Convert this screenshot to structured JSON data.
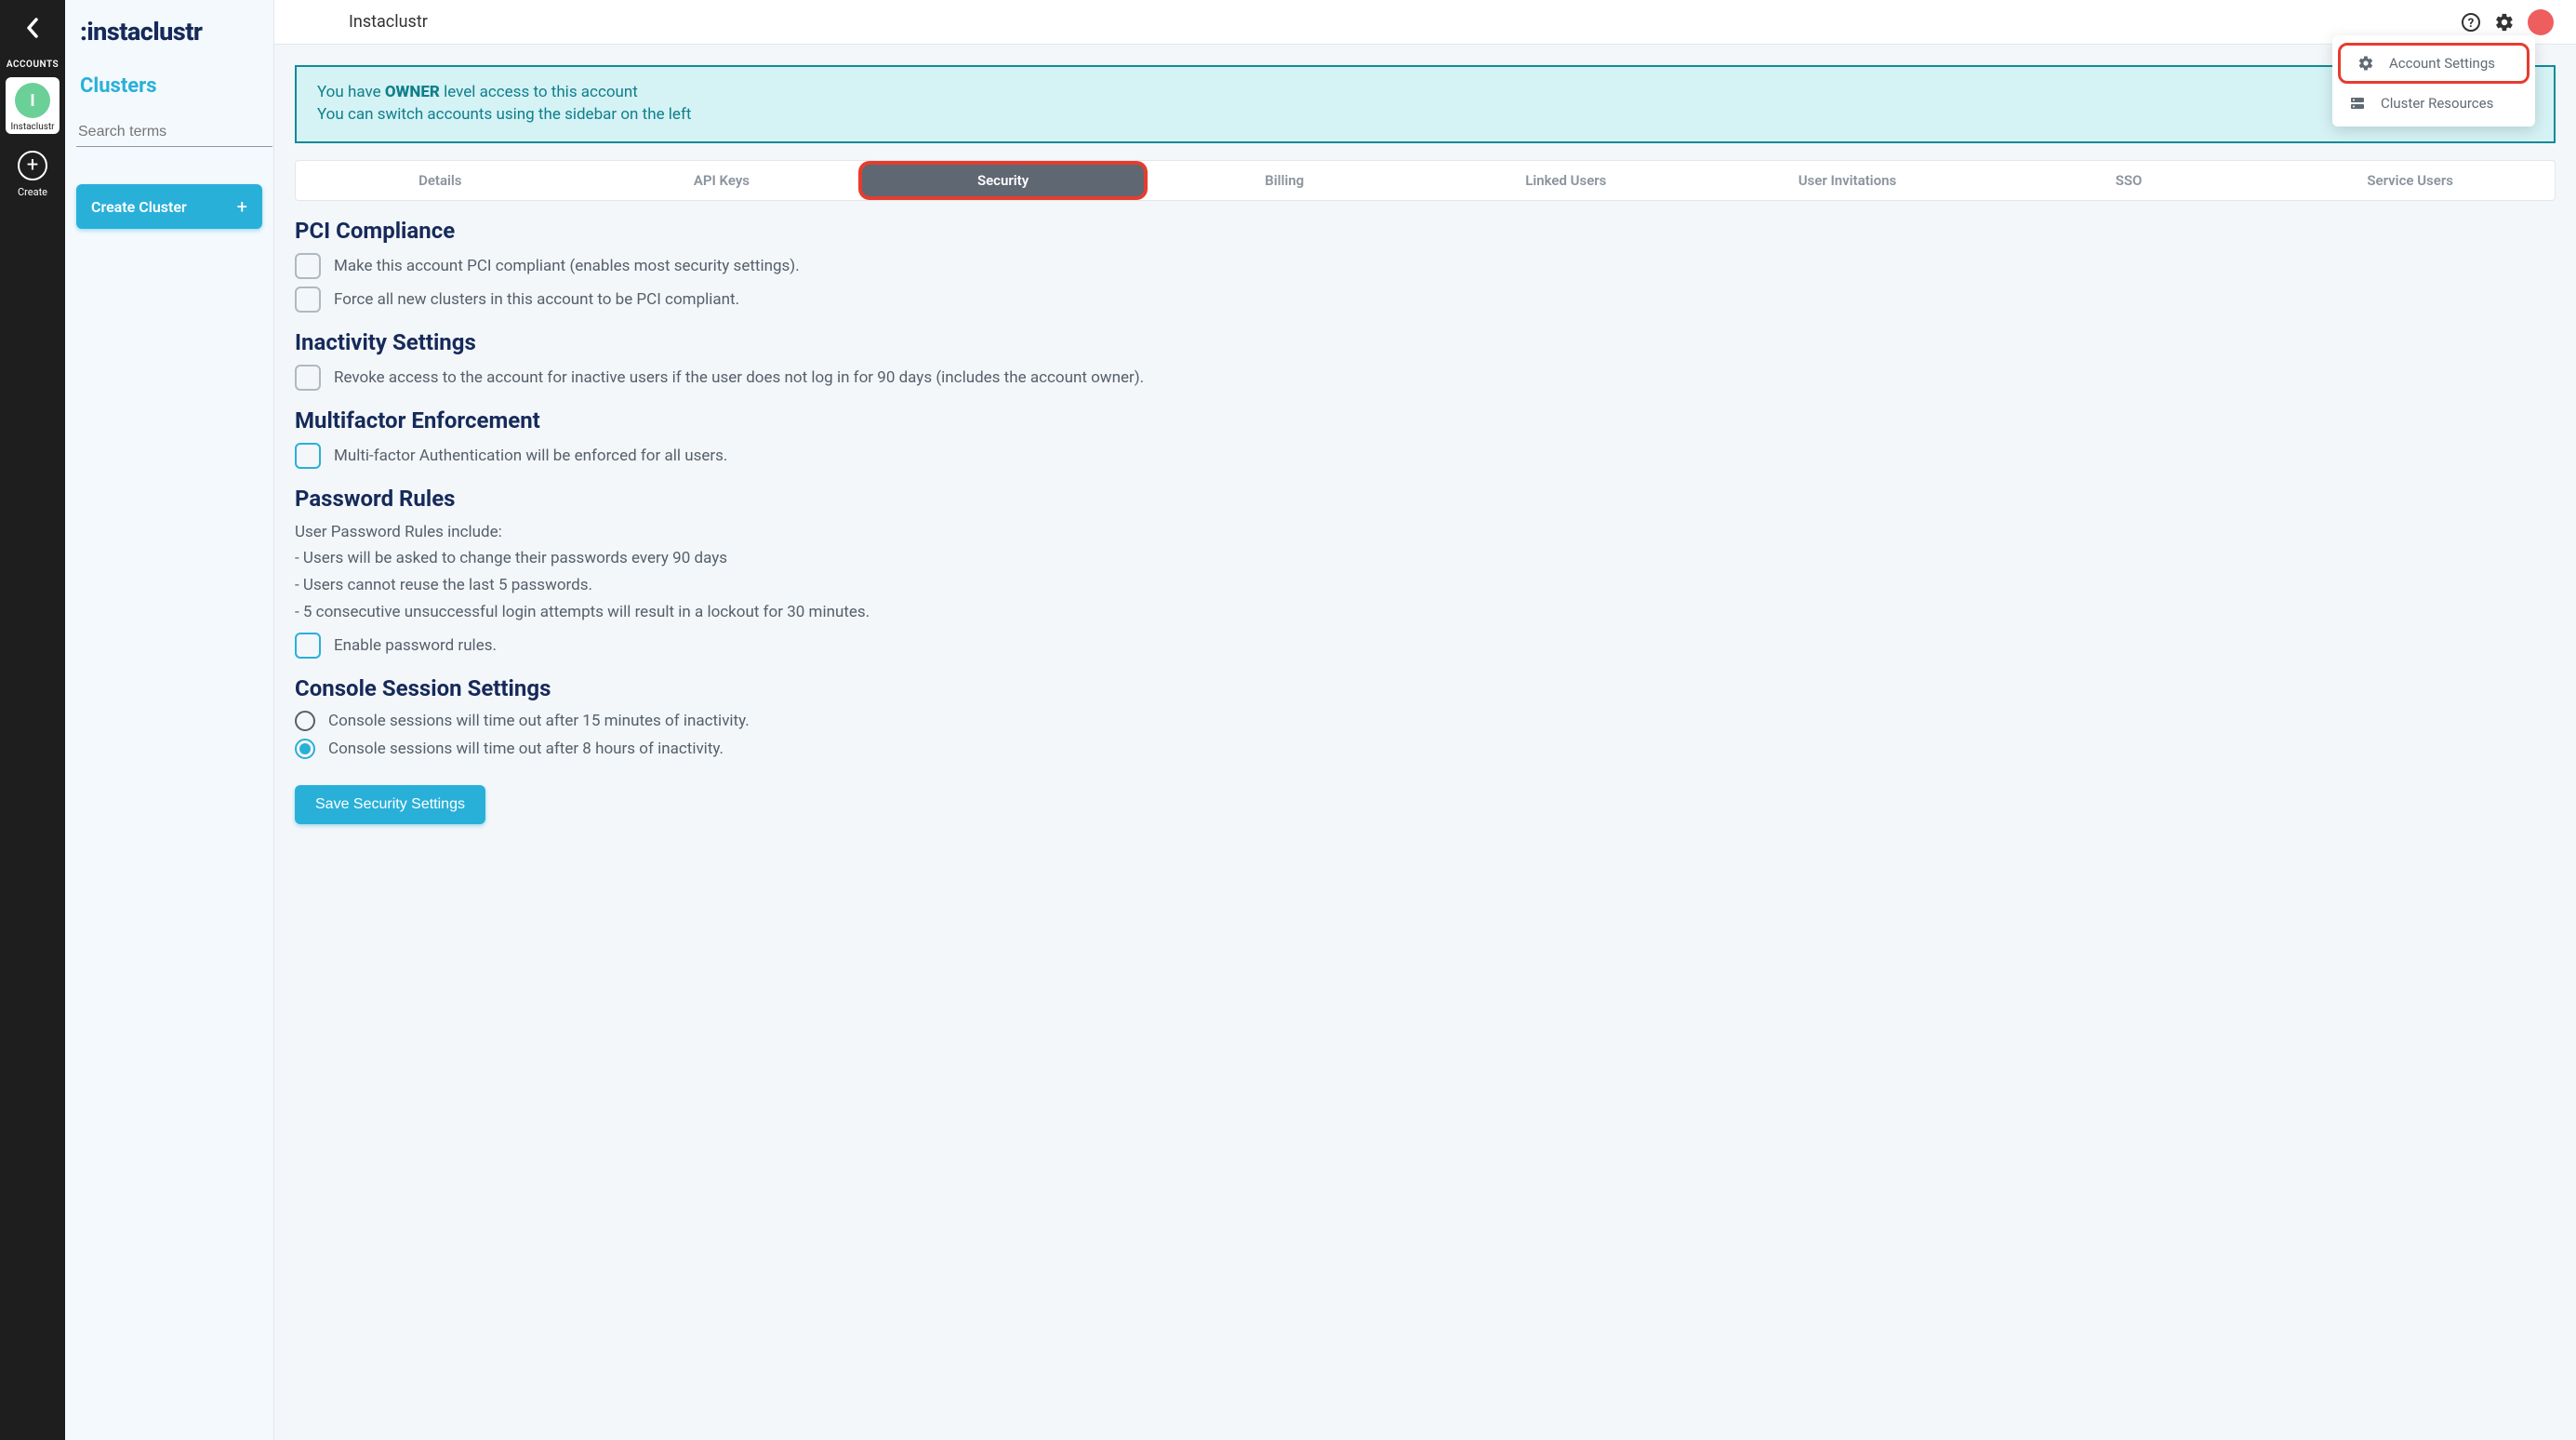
{
  "rail": {
    "accounts_label": "ACCOUNTS",
    "account_initial": "I",
    "account_name": "Instaclustr",
    "create_label": "Create"
  },
  "sidebar": {
    "brand": "instaclustr",
    "heading": "Clusters",
    "search_placeholder": "Search terms",
    "create_cluster_label": "Create Cluster"
  },
  "topbar": {
    "title": "Instaclustr"
  },
  "dropdown": {
    "items": [
      {
        "label": "Account Settings",
        "highlighted": true
      },
      {
        "label": "Cluster Resources",
        "highlighted": false
      }
    ]
  },
  "banner": {
    "line1_pre": "You have ",
    "line1_bold": "OWNER",
    "line1_post": " level access to this account",
    "line2": "You can switch accounts using the sidebar on the left"
  },
  "tabs": [
    {
      "label": "Details",
      "active": false
    },
    {
      "label": "API Keys",
      "active": false
    },
    {
      "label": "Security",
      "active": true
    },
    {
      "label": "Billing",
      "active": false
    },
    {
      "label": "Linked Users",
      "active": false
    },
    {
      "label": "User Invitations",
      "active": false
    },
    {
      "label": "SSO",
      "active": false
    },
    {
      "label": "Service Users",
      "active": false
    }
  ],
  "sections": {
    "pci": {
      "heading": "PCI Compliance",
      "opt1": "Make this account PCI compliant (enables most security settings).",
      "opt2": "Force all new clusters in this account to be PCI compliant."
    },
    "inactivity": {
      "heading": "Inactivity Settings",
      "opt1": "Revoke access to the account for inactive users if the user does not log in for 90 days (includes the account owner)."
    },
    "mfa": {
      "heading": "Multifactor Enforcement",
      "opt1": "Multi-factor Authentication will be enforced for all users."
    },
    "password": {
      "heading": "Password Rules",
      "intro": "User Password Rules include:",
      "rule1": "- Users will be asked to change their passwords every 90 days",
      "rule2": "- Users cannot reuse the last 5 passwords.",
      "rule3": "- 5 consecutive unsuccessful login attempts will result in a lockout for 30 minutes.",
      "opt1": "Enable password rules."
    },
    "console": {
      "heading": "Console Session Settings",
      "opt1": "Console sessions will time out after 15 minutes of inactivity.",
      "opt2": "Console sessions will time out after 8 hours of inactivity."
    }
  },
  "save_button": "Save Security Settings"
}
